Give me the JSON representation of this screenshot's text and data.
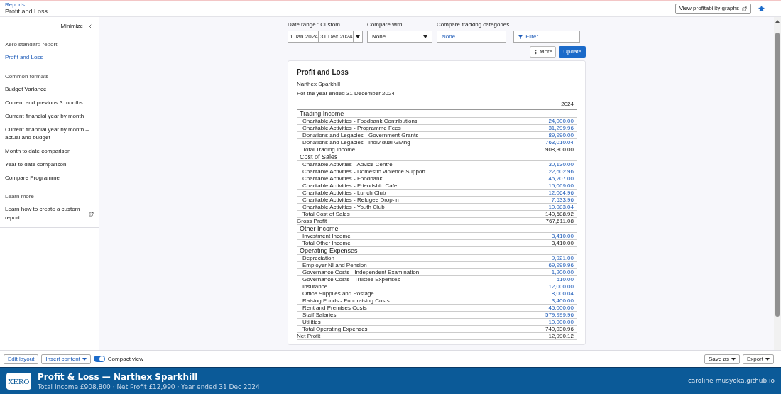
{
  "header": {
    "breadcrumb": "Reports",
    "title": "Profit and Loss",
    "graphs_button": "View profitability graphs",
    "favorite": true
  },
  "sidebar": {
    "minimize": "Minimize",
    "sections": [
      {
        "heading": "Xero standard report",
        "items": [
          {
            "label": "Profit and Loss",
            "kind": "link"
          }
        ]
      },
      {
        "heading": "Common formats",
        "items": [
          {
            "label": "Budget Variance",
            "kind": "item"
          },
          {
            "label": "Current and previous 3 months",
            "kind": "item"
          },
          {
            "label": "Current financial year by month",
            "kind": "item"
          },
          {
            "label": "Current financial year by month – actual and budget",
            "kind": "item"
          },
          {
            "label": "Month to date comparison",
            "kind": "item"
          },
          {
            "label": "Year to date comparison",
            "kind": "item"
          },
          {
            "label": "Compare Programme",
            "kind": "item"
          }
        ]
      },
      {
        "heading": "Learn more",
        "items": [
          {
            "label": "Learn how to create a custom report",
            "kind": "external"
          }
        ]
      }
    ]
  },
  "filters": {
    "date_label": "Date range : Custom",
    "date_from": "1 Jan 2024",
    "date_to": "31 Dec 2024",
    "compare_label": "Compare with",
    "compare_value": "None",
    "tracking_label": "Compare tracking categories",
    "tracking_value": "None",
    "filter_button": "Filter",
    "more_button": "More",
    "update_button": "Update"
  },
  "report": {
    "title": "Profit and Loss",
    "organisation": "Narthex Sparkhill",
    "period": "For the year ended 31 December 2024",
    "column": "2024",
    "rows": [
      {
        "kind": "section",
        "label": "Trading Income"
      },
      {
        "kind": "account",
        "label": "Charitable Activities - Foodbank Contributions",
        "value": "24,000.00"
      },
      {
        "kind": "account",
        "label": "Charitable Activities - Programme Fees",
        "value": "31,299.96"
      },
      {
        "kind": "account",
        "label": "Donations and Legacies - Government Grants",
        "value": "89,990.00"
      },
      {
        "kind": "account",
        "label": "Donations and Legacies - Individual Giving",
        "value": "763,010.04"
      },
      {
        "kind": "total",
        "label": "Total Trading Income",
        "value": "908,300.00"
      },
      {
        "kind": "section",
        "label": "Cost of Sales"
      },
      {
        "kind": "account",
        "label": "Charitable Activities - Advice Centre",
        "value": "30,130.00"
      },
      {
        "kind": "account",
        "label": "Charitable Activities - Domestic Violence Support",
        "value": "22,602.96"
      },
      {
        "kind": "account",
        "label": "Charitable Activities - Foodbank",
        "value": "45,207.00"
      },
      {
        "kind": "account",
        "label": "Charitable Activities - Friendship Cafe",
        "value": "15,069.00"
      },
      {
        "kind": "account",
        "label": "Charitable Activities - Lunch Club",
        "value": "12,064.96"
      },
      {
        "kind": "account",
        "label": "Charitable Activities - Refugee Drop-in",
        "value": "7,533.96"
      },
      {
        "kind": "account",
        "label": "Charitable Activities - Youth Club",
        "value": "10,083.04"
      },
      {
        "kind": "total",
        "label": "Total Cost of Sales",
        "value": "140,688.92"
      },
      {
        "kind": "summary",
        "label": "Gross Profit",
        "value": "767,611.08"
      },
      {
        "kind": "section",
        "label": "Other Income"
      },
      {
        "kind": "account",
        "label": "Investment Income",
        "value": "3,410.00"
      },
      {
        "kind": "total",
        "label": "Total Other Income",
        "value": "3,410.00"
      },
      {
        "kind": "section",
        "label": "Operating Expenses"
      },
      {
        "kind": "account",
        "label": "Depreciation",
        "value": "9,921.00"
      },
      {
        "kind": "account",
        "label": "Employer NI and Pension",
        "value": "69,999.96"
      },
      {
        "kind": "account",
        "label": "Governance Costs - Independent Examination",
        "value": "1,200.00"
      },
      {
        "kind": "account",
        "label": "Governance Costs - Trustee Expenses",
        "value": "510.00"
      },
      {
        "kind": "account",
        "label": "Insurance",
        "value": "12,000.00"
      },
      {
        "kind": "account",
        "label": "Office Supplies and Postage",
        "value": "8,000.04"
      },
      {
        "kind": "account",
        "label": "Raising Funds - Fundraising Costs",
        "value": "3,400.00"
      },
      {
        "kind": "account",
        "label": "Rent and Premises Costs",
        "value": "45,000.00"
      },
      {
        "kind": "account",
        "label": "Staff Salaries",
        "value": "579,999.96"
      },
      {
        "kind": "account",
        "label": "Utilities",
        "value": "10,000.00"
      },
      {
        "kind": "total",
        "label": "Total Operating Expenses",
        "value": "740,030.96"
      },
      {
        "kind": "summary",
        "label": "Net Profit",
        "value": "12,990.12"
      }
    ]
  },
  "toolbar": {
    "edit_layout": "Edit layout",
    "insert_content": "Insert content",
    "compact_view": {
      "label": "Compact view",
      "on": true
    },
    "save_as": "Save as",
    "export": "Export"
  },
  "banner": {
    "logo": "XERO",
    "title": "Profit & Loss — Narthex Sparkhill",
    "subtitle": "Total Income £908,800 · Net Profit £12,990 · Year ended 31 Dec 2024",
    "site": "caroline-musyoka.github.io"
  }
}
